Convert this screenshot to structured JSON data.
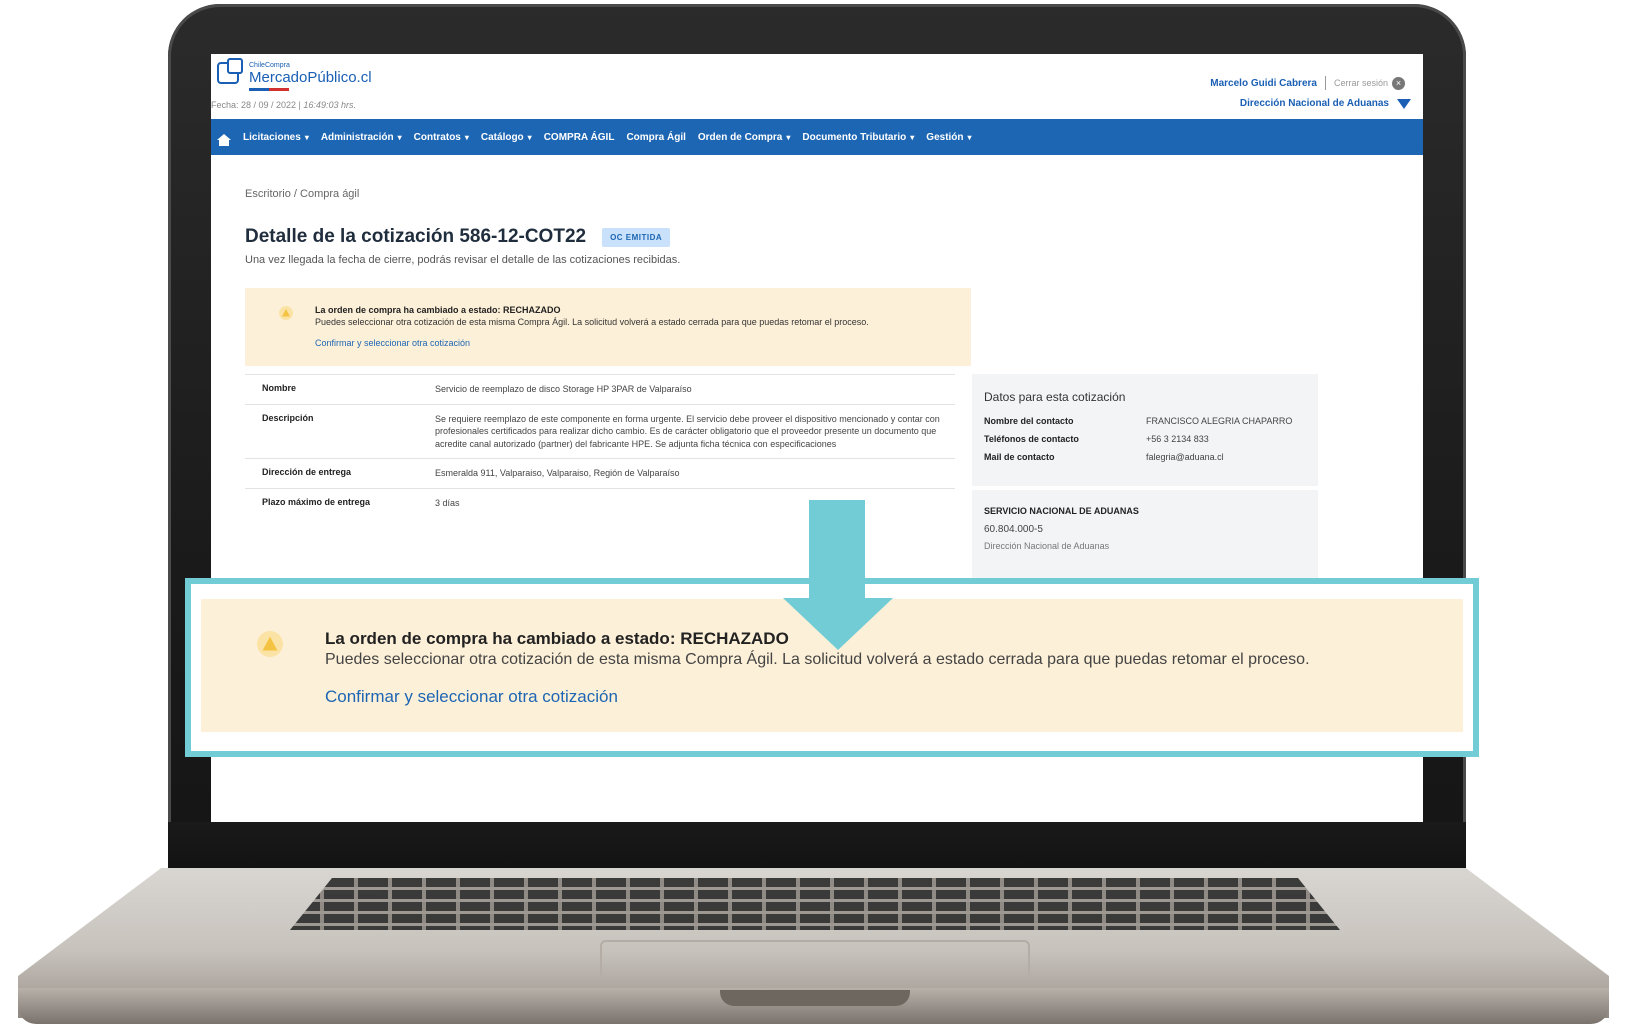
{
  "header": {
    "logo_small": "ChileCompra",
    "logo_big": "MercadoPúblico.cl",
    "date_label": "Fecha: 28 / 09 / 2022 |",
    "time_label": "16:49:03 hrs.",
    "user_name": "Marcelo Guidi Cabrera",
    "logout_label": "Cerrar sesión",
    "organization": "Dirección Nacional de Aduanas"
  },
  "nav": {
    "items": [
      {
        "label": "Licitaciones",
        "caret": "▾"
      },
      {
        "label": "Administración",
        "caret": "▾"
      },
      {
        "label": "Contratos",
        "caret": "▾"
      },
      {
        "label": "Catálogo",
        "caret": "▾"
      },
      {
        "label": "COMPRA ÁGIL",
        "caret": ""
      },
      {
        "label": "Compra Ágil",
        "caret": ""
      },
      {
        "label": "Orden de Compra",
        "caret": "▾"
      },
      {
        "label": "Documento Tributario",
        "caret": "▾"
      },
      {
        "label": "Gestión",
        "caret": "▾"
      }
    ]
  },
  "page": {
    "breadcrumb": "Escritorio / Compra ágil",
    "title": "Detalle de la cotización 586-12-COT22",
    "badge": "OC EMITIDA",
    "subtitle": "Una vez llegada la fecha de cierre, podrás revisar el detalle de las cotizaciones recibidas."
  },
  "alert": {
    "title": "La orden de compra ha cambiado a estado: RECHAZADO",
    "text": "Puedes seleccionar otra cotización de esta misma Compra Ágil. La solicitud volverá a estado cerrada para que puedas retomar el proceso.",
    "link": "Confirmar y seleccionar otra cotización"
  },
  "details": [
    {
      "label": "Nombre",
      "value": "Servicio de reemplazo de disco Storage HP 3PAR de Valparaíso"
    },
    {
      "label": "Descripción",
      "value": "Se requiere reemplazo de este componente en forma urgente. El servicio debe proveer el dispositivo mencionado y contar con profesionales certificados para realizar dicho cambio. Es de carácter obligatorio que el proveedor presente un documento que acredite canal autorizado (partner) del fabricante HPE. Se adjunta ficha técnica con especificaciones"
    },
    {
      "label": "Dirección de entrega",
      "value": "Esmeralda 911, Valparaiso, Valparaiso, Región de Valparaíso"
    },
    {
      "label": "Plazo máximo de entrega",
      "value": "3 días"
    }
  ],
  "contact": {
    "title": "Datos para esta cotización",
    "rows": [
      {
        "label": "Nombre del contacto",
        "value": "FRANCISCO ALEGRIA CHAPARRO"
      },
      {
        "label": "Teléfonos de contacto",
        "value": "+56 3 2134 833"
      },
      {
        "label": "Mail de contacto",
        "value": "falegria@aduana.cl"
      }
    ]
  },
  "buyer": {
    "name": "SERVICIO NACIONAL DE ADUANAS",
    "rut": "60.804.000-5",
    "unit": "Dirección Nacional de Aduanas"
  },
  "colors": {
    "nav_blue": "#1d66b3",
    "alert_bg": "#fdf0d8",
    "warning_yellow": "#f5c342",
    "callout_teal": "#72ccd6"
  }
}
